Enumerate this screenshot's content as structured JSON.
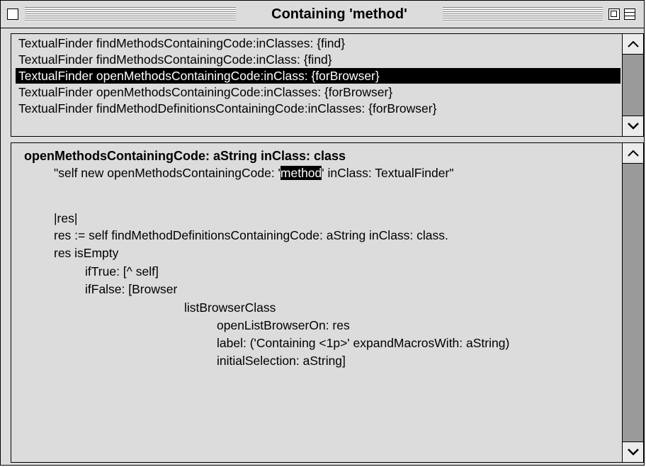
{
  "window": {
    "title": "Containing 'method'"
  },
  "list": {
    "items": [
      "TextualFinder findMethodsContainingCode:inClasses: {find}",
      "TextualFinder findMethodsContainingCode:inClass: {find}",
      "TextualFinder openMethodsContainingCode:inClass: {forBrowser}",
      "TextualFinder openMethodsContainingCode:inClasses: {forBrowser}",
      "TextualFinder findMethodDefinitionsContainingCode:inClasses: {forBrowser}"
    ],
    "selected_index": 2
  },
  "code": {
    "header": "openMethodsContainingCode: aString inClass: class",
    "comment_before": "\"self new openMethodsContainingCode: '",
    "comment_highlight": "method",
    "comment_after": "' inClass: TextualFinder\"",
    "lines": [
      "|res|",
      "res := self findMethodDefinitionsContainingCode: aString inClass: class.",
      "res isEmpty",
      "ifTrue: [^ self]",
      "ifFalse: [Browser",
      "listBrowserClass",
      "openListBrowserOn: res",
      "label: ('Containing  <1p>' expandMacrosWith: aString)",
      "initialSelection: aString]"
    ]
  },
  "icons": {
    "close": "close-box-icon",
    "zoom": "zoom-box-icon",
    "collapse": "collapse-box-icon",
    "scroll_up": "arrow-up-icon",
    "scroll_down": "arrow-down-icon"
  },
  "colors": {
    "chrome": "#dcdcdc",
    "selection": "#000000",
    "scroll_track": "#9a9a9a"
  }
}
